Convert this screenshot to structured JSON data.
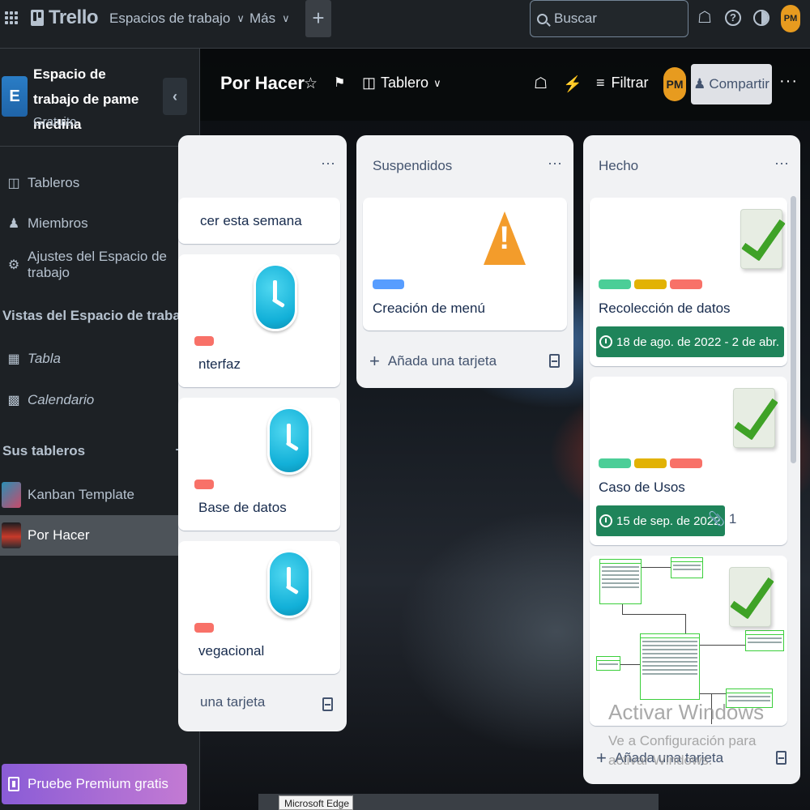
{
  "topbar": {
    "logo": "Trello",
    "nav": [
      {
        "label": "Espacios de trabajo"
      },
      {
        "label": "Más"
      }
    ],
    "search_placeholder": "Buscar",
    "user_initials": "PM"
  },
  "sidebar": {
    "workspace_initial": "E",
    "workspace_name": "Espacio de trabajo de pame medina",
    "workspace_plan": "Gratuito",
    "menu": [
      {
        "label": "Tableros"
      },
      {
        "label": "Miembros"
      },
      {
        "label": "Ajustes del Espacio de trabajo"
      }
    ],
    "views_heading": "Vistas del Espacio de trabajo",
    "views": [
      {
        "label": "Tabla"
      },
      {
        "label": "Calendario"
      }
    ],
    "boards_heading": "Sus tableros",
    "boards": [
      {
        "label": "Kanban Template"
      },
      {
        "label": "Por Hacer"
      }
    ],
    "premium_label": "Pruebe Premium gratis"
  },
  "board": {
    "title": "Por Hacer",
    "view_label": "Tablero",
    "filter_label": "Filtrar",
    "member_initials": "PM",
    "share_label": "Compartir"
  },
  "lists": [
    {
      "title": "",
      "cards": [
        {
          "text": "cer esta semana"
        },
        {
          "text": "nterfaz"
        },
        {
          "text": "Base de datos"
        },
        {
          "text": "vegacional"
        }
      ],
      "add_label": "una tarjeta"
    },
    {
      "title": "Suspendidos",
      "cards": [
        {
          "text": "Creación de menú"
        }
      ],
      "add_label": "Añada una tarjeta"
    },
    {
      "title": "Hecho",
      "cards": [
        {
          "text": "Recolección de datos",
          "due": "18 de ago. de 2022 - 2 de abr."
        },
        {
          "text": "Caso de Usos",
          "due": "15 de sep. de 2022",
          "attachments": "1"
        }
      ],
      "add_label": "Añada una tarjeta"
    }
  ],
  "overlay": {
    "watermark_title": "Activar Windows",
    "watermark_sub": "Ve a Configuración para activar Windows.",
    "taskbar_tooltip": "Microsoft Edge"
  },
  "colors": {
    "label_blue": "#579dff",
    "label_green": "#4bce97",
    "label_yellow": "#e2b203",
    "label_red": "#f87168",
    "due_complete": "#1f845a"
  }
}
